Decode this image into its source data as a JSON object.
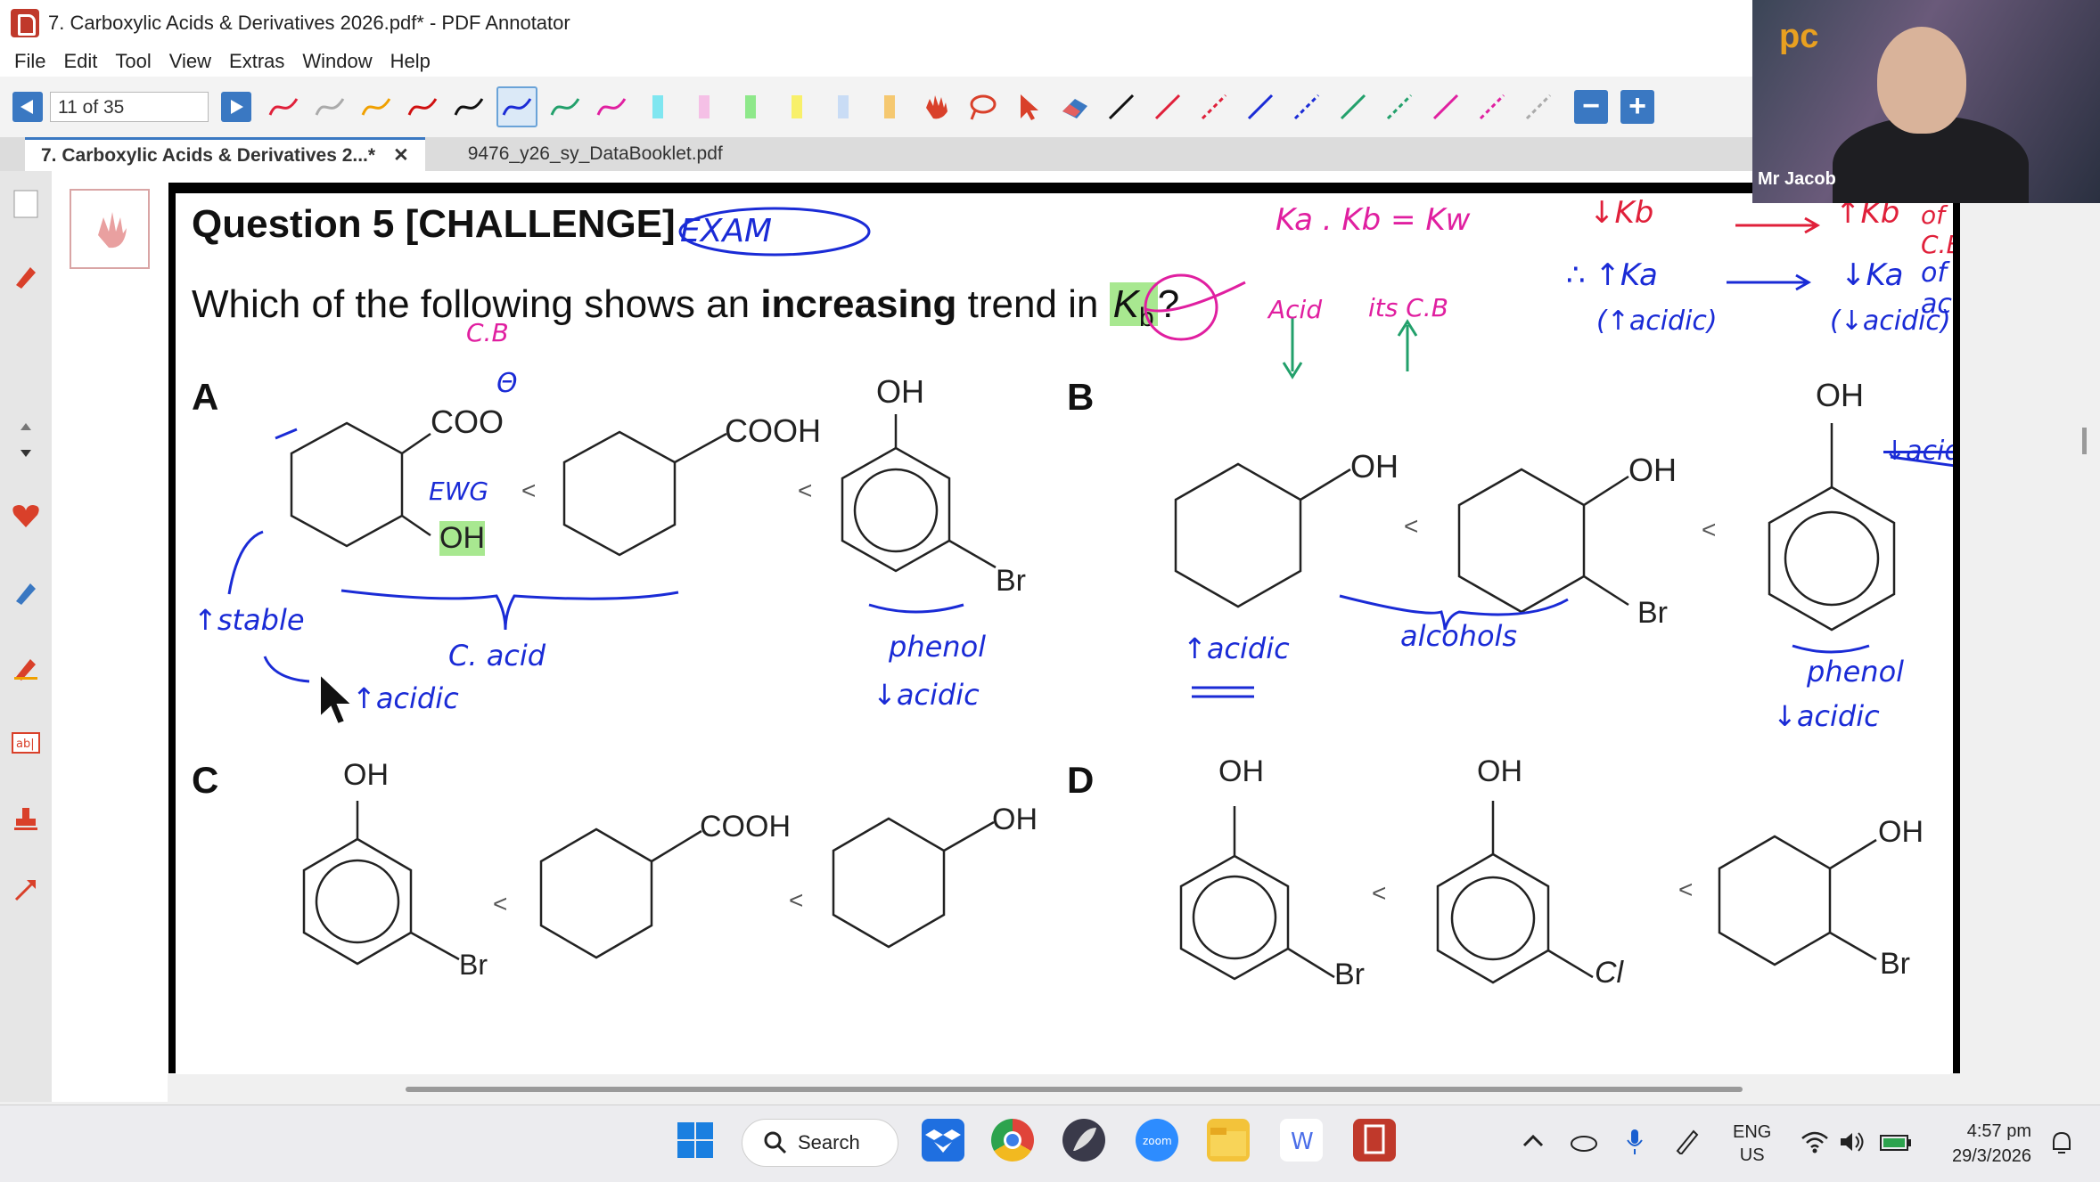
{
  "window": {
    "title": "7. Carboxylic Acids & Derivatives 2026.pdf* - PDF Annotator"
  },
  "menu": [
    "File",
    "Edit",
    "Tool",
    "View",
    "Extras",
    "Window",
    "Help"
  ],
  "toolbar": {
    "page_indicator": "11 of 35",
    "zoom_out": "−",
    "zoom_in": "+"
  },
  "tabs": [
    {
      "label": "7. Carboxylic Acids & Derivatives 2...*",
      "close": "✕",
      "active": true
    },
    {
      "label": "9476_y26_sy_DataBooklet.pdf",
      "active": false
    }
  ],
  "document": {
    "question_title": "Question 5 [CHALLENGE]",
    "question_prefix": "Which of the following shows an ",
    "question_bold": "increasing",
    "question_mid": " trend in ",
    "question_kb_k": "K",
    "question_kb_b": "b",
    "question_end": "?",
    "options": {
      "a": "A",
      "b": "B",
      "c": "C",
      "d": "D"
    },
    "lt": "<",
    "chem": {
      "coo": "COO",
      "cooh": "COOH",
      "oh": "OH",
      "oh_short": "OH",
      "br": "Br",
      "cl": "Cl"
    }
  },
  "annotations": {
    "exam": "EXAM",
    "ka_kb_kw": "Ka . Kb = Kw",
    "acid": "Acid",
    "its_cb": "its C.B",
    "dec_kb": "↓Kb",
    "inc_kb": "↑Kb",
    "of_cb": "of C.B",
    "therefore_inc_ka": "∴ ↑Ka",
    "inc_acidic": "(↑acidic)",
    "dec_ka": "↓Ka",
    "dec_acidic": "(↓acidic)",
    "of_acid": "of acid",
    "cb": "C.B",
    "theta": "Θ",
    "ewg": "EWG",
    "inc_stable": "↑stable",
    "c_acid": "C. acid",
    "inc_acidic_short": "↑acidic",
    "phenol": "phenol",
    "dec_acidic_short": "↓acidic",
    "inc_acidic_b": "↑acidic",
    "alcohols": "alcohols",
    "phenol_b": "phenol",
    "dec_acidic_b": "↓acidic",
    "crossed": "↓acidic"
  },
  "webcam": {
    "name": "Mr Jacob",
    "logo": "pc"
  },
  "taskbar": {
    "search": "Search",
    "lang1": "ENG",
    "lang2": "US",
    "time": "4:57 pm",
    "date": "29/3/2026"
  },
  "colors": {
    "accent": "#3a78c2",
    "ink_blue": "#1a2bd6",
    "ink_magenta": "#e01fa0",
    "ink_red": "#e0203a",
    "ink_green": "#22a06b",
    "highlight": "#a8e890"
  }
}
